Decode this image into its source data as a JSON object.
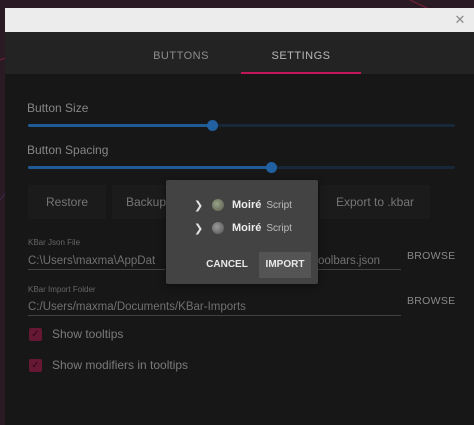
{
  "window": {
    "close_glyph": "✕"
  },
  "tabs": [
    {
      "label": "BUTTONS",
      "active": false
    },
    {
      "label": "SETTINGS",
      "active": true
    }
  ],
  "settings": {
    "button_size": {
      "label": "Button Size",
      "value_fraction": 0.43
    },
    "button_spacing": {
      "label": "Button Spacing",
      "value_fraction": 0.57
    },
    "actions": [
      "Restore",
      "Backup",
      "Export to .kbar"
    ],
    "kbar_json_file": {
      "label": "KBar Json File",
      "value_prefix": "C:\\Users\\maxma\\AppDat",
      "value_suffix": "oolbars.json",
      "browse": "BROWSE"
    },
    "kbar_import_folder": {
      "label": "KBar Import Folder",
      "value": "C:/Users/maxma/Documents/KBar-Imports",
      "browse": "BROWSE"
    },
    "show_tooltips": {
      "label": "Show tooltips",
      "checked": true
    },
    "show_modifiers": {
      "label": "Show modifiers in tooltips",
      "checked": true
    }
  },
  "dialog": {
    "items": [
      {
        "name": "Moiré",
        "type": "Script",
        "icon": "moire-script-icon"
      },
      {
        "name": "Moiré",
        "type": "Script",
        "icon": "moire-script-icon"
      }
    ],
    "cancel_label": "CANCEL",
    "import_label": "IMPORT"
  },
  "colors": {
    "accent": "#c2185b",
    "slider": "#2f86e0",
    "checkbox": "#8e2047",
    "panel": "#202020",
    "dialog": "#434343"
  }
}
